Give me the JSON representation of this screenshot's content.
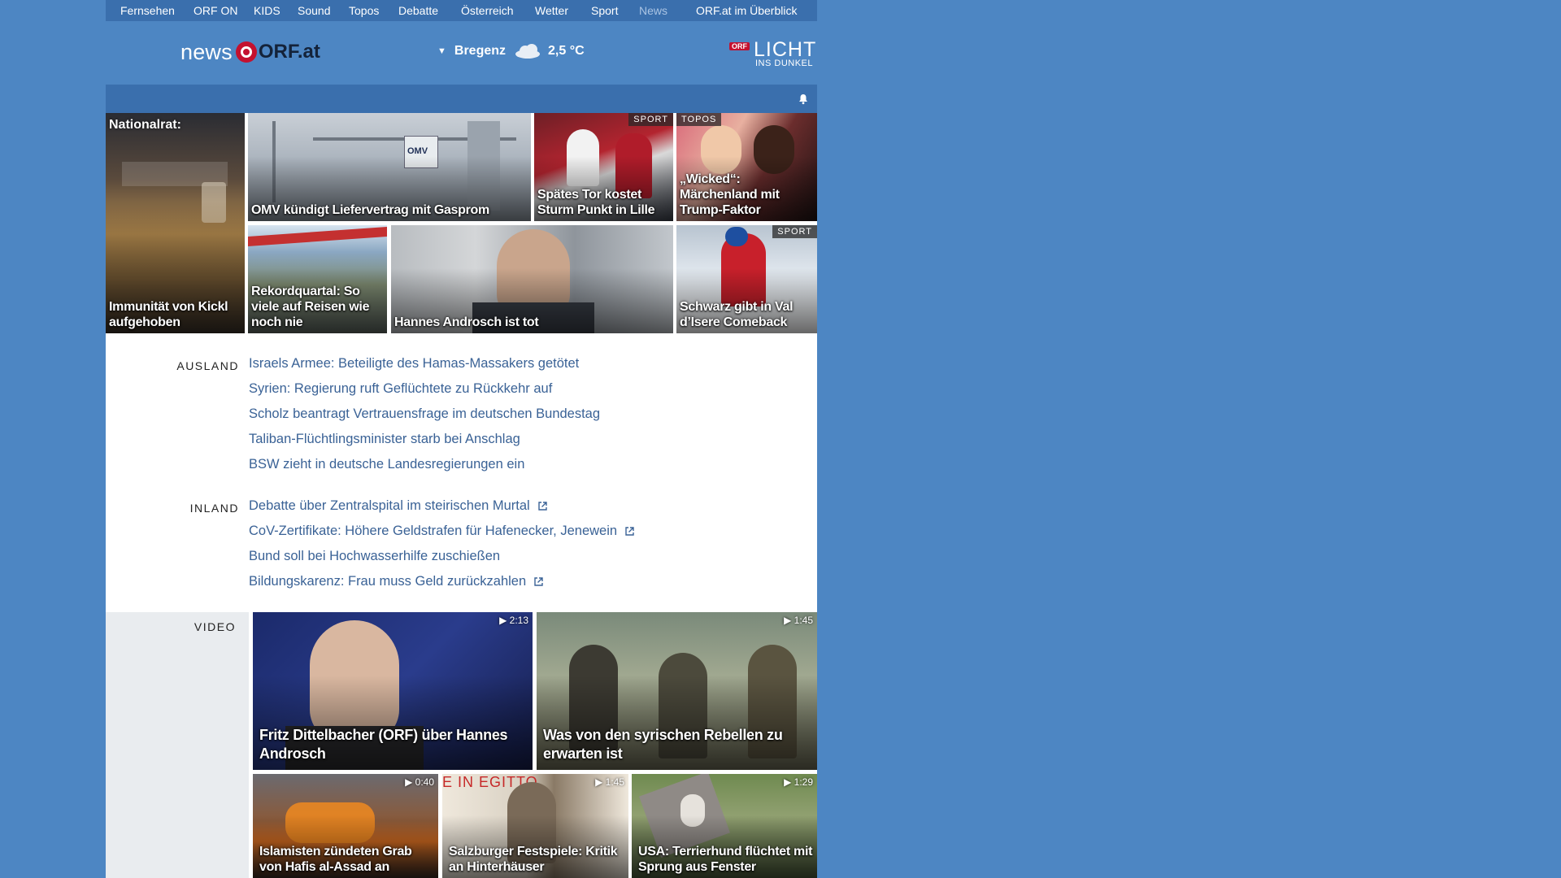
{
  "nav": {
    "items": [
      "Fernsehen",
      "ORF ON",
      "KIDS",
      "Sound",
      "Topos",
      "Debatte",
      "Österreich",
      "Wetter",
      "Sport",
      "News"
    ],
    "overview": "ORF.at im Überblick"
  },
  "header": {
    "logo_news": "news",
    "logo_orf": "ORF.at",
    "weather_city": "Bregenz",
    "weather_temp": "2,5 °C",
    "weather_icon": "cloud-icon",
    "licht_tag": "ORF",
    "licht_title": "LICHT",
    "licht_subtitle": "INS DUNKEL"
  },
  "colors": {
    "page_bg": "#4d86c3",
    "nav_bg": "#3a6fad",
    "link": "#3a6296",
    "orf_red": "#c4112f"
  },
  "tiles": [
    {
      "top": "Nationalrat:",
      "caption": "Immunität von Kickl aufgehoben",
      "badge": ""
    },
    {
      "caption": "OMV kündigt Liefervertrag mit Gasprom",
      "badge": "",
      "logo": "OMV"
    },
    {
      "caption": "Spätes Tor kostet Sturm Punkt in Lille",
      "badge": "SPORT"
    },
    {
      "caption": "„Wicked“: Märchenland mit Trump-Faktor",
      "badge": "TOPOS"
    },
    {
      "caption": "Rekordquartal: So viele auf Reisen wie noch nie",
      "badge": ""
    },
    {
      "caption": "Hannes Androsch ist tot",
      "badge": ""
    },
    {
      "caption": "Schwarz gibt in Val d’Isere Comeback",
      "badge": "SPORT"
    }
  ],
  "ausland": {
    "label": "AUSLAND",
    "stories": [
      "Israels Armee: Beteiligte des Hamas-Massakers getötet",
      "Syrien: Regierung ruft Geflüchtete zu Rückkehr auf",
      "Scholz beantragt Vertrauensfrage im deutschen Bundestag",
      "Taliban-Flüchtlingsminister starb bei Anschlag",
      "BSW zieht in deutsche Landesregierungen ein"
    ]
  },
  "inland": {
    "label": "INLAND",
    "stories": [
      {
        "text": "Debatte über Zentralspital im steirischen Murtal",
        "external": true
      },
      {
        "text": "CoV-Zertifikate: Höhere Geldstrafen für Hafenecker, Jenewein",
        "external": true
      },
      {
        "text": "Bund soll bei Hochwasserhilfe zuschießen",
        "external": false
      },
      {
        "text": "Bildungskarenz: Frau muss Geld zurückzahlen",
        "external": true
      }
    ]
  },
  "video": {
    "label": "VIDEO",
    "items": [
      {
        "caption": "Fritz Dittelbacher (ORF) über Hannes Androsch",
        "duration": "2:13"
      },
      {
        "caption": "Was von den syrischen Rebellen zu erwarten ist",
        "duration": "1:45"
      },
      {
        "caption": "Islamisten zündeten Grab von Hafis al-Assad an",
        "duration": "0:40"
      },
      {
        "caption": "Salzburger Festspiele: Kritik an Hinterhäuser",
        "duration": "1:45",
        "overlay": "E IN EGITTO"
      },
      {
        "caption": "USA: Terrierhund flüchtet mit Sprung aus Fenster",
        "duration": "1:29"
      }
    ]
  }
}
